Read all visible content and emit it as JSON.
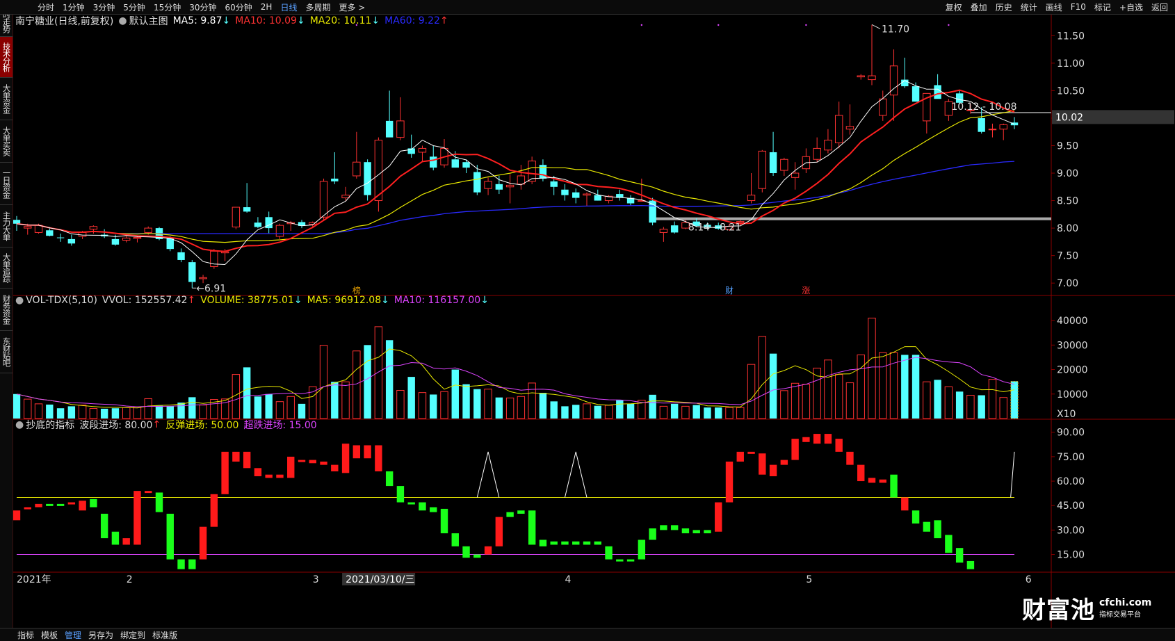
{
  "topbar": {
    "left": [
      "分时",
      "1分钟",
      "3分钟",
      "5分钟",
      "15分钟",
      "30分钟",
      "60分钟",
      "2H",
      "日线",
      "多周期",
      "更多 >"
    ],
    "active": "日线",
    "right": [
      "复权",
      "叠加",
      "历史",
      "统计",
      "画线",
      "F10",
      "标记",
      "+自选",
      "返回"
    ]
  },
  "sidebar": [
    {
      "label": "分时走势",
      "h": 52
    },
    {
      "label": "技术分析",
      "h": 58,
      "active": true
    },
    {
      "label": "大单资金",
      "h": 60
    },
    {
      "label": "大单买卖",
      "h": 60
    },
    {
      "label": "一日资金",
      "h": 60
    },
    {
      "label": "主力大单",
      "h": 60
    },
    {
      "label": "大单追踪",
      "h": 58
    },
    {
      "label": "财务资金",
      "h": 60
    },
    {
      "label": "东财贴吧",
      "h": 60
    }
  ],
  "main_header": {
    "title": "南宁糖业(日线,前复权)",
    "template": "默认主图",
    "ma5": "MA5: 9.87",
    "ma5_arrow": "↓",
    "ma10": "MA10: 10.09",
    "ma10_arrow": "↓",
    "ma20": "MA20: 10.11",
    "ma20_arrow": "↓",
    "ma60": "MA60: 9.22",
    "ma60_arrow": "↑"
  },
  "vol_header": {
    "name": "VOL-TDX(5,10)",
    "vvol": "VVOL: 152557.42",
    "vvol_arrow": "↑",
    "volume": "VOLUME: 38775.01",
    "volume_arrow": "↓",
    "ma5": "MA5: 96912.08",
    "ma5_arrow": "↓",
    "ma10": "MA10: 116157.00",
    "ma10_arrow": "↓"
  },
  "ind_header": {
    "name": "抄底的指标",
    "wave": "波段进场: 80.00",
    "wave_arrow": "↑",
    "rebound": "反弹进场: 50.00",
    "oversold": "超跌进场: 15.00"
  },
  "colors": {
    "up": "#ff3232",
    "down": "#54ffff",
    "ma5": "#ffffff",
    "ma10": "#ff2020",
    "ma20": "#e8e800",
    "ma60": "#2a2aff",
    "vma5": "#e8e800",
    "vma10": "#dd44ff",
    "line50": "#e8e800",
    "line15": "#dd44ff",
    "axis": "#8a0000"
  },
  "chart_data": {
    "type": "candlestick",
    "price_axis": [
      "11.50",
      "11.00",
      "10.50",
      "10.00",
      "9.50",
      "9.00",
      "8.50",
      "8.00",
      "7.50",
      "7.00"
    ],
    "vol_axis": [
      "40000",
      "30000",
      "20000",
      "10000"
    ],
    "vol_unit": "X10",
    "ind_axis": [
      "90.00",
      "75.00",
      "60.00",
      "45.00",
      "30.00",
      "15.00"
    ],
    "current_price": "10.02",
    "labels": {
      "high": "11.70",
      "low": "6.91",
      "resistance": "10.12 - 10.08",
      "support": "8.14 - 8.21"
    },
    "markers": [
      {
        "text": "榜",
        "day": "2021/03/10"
      },
      {
        "text": "财",
        "day": "2021/04/29"
      },
      {
        "text": "涨",
        "day": "2021/05/13"
      }
    ],
    "x_labels": [
      "2021年",
      "2",
      "3",
      "4",
      "5",
      "6"
    ],
    "cursor_date": "2021/03/10/三",
    "ohlc": [
      [
        8.15,
        8.22,
        7.95,
        8.08
      ],
      [
        8.0,
        8.08,
        7.88,
        8.03
      ],
      [
        7.92,
        8.08,
        7.9,
        8.05
      ],
      [
        7.96,
        8.02,
        7.85,
        7.86
      ],
      [
        7.83,
        7.9,
        7.75,
        7.82
      ],
      [
        7.8,
        7.88,
        7.68,
        7.72
      ],
      [
        7.85,
        7.95,
        7.8,
        7.92
      ],
      [
        7.98,
        8.05,
        7.9,
        8.03
      ],
      [
        7.88,
        7.98,
        7.82,
        7.85
      ],
      [
        7.8,
        7.88,
        7.68,
        7.7
      ],
      [
        7.78,
        7.85,
        7.74,
        7.82
      ],
      [
        7.81,
        7.87,
        7.74,
        7.83
      ],
      [
        7.92,
        8.03,
        7.88,
        8.0
      ],
      [
        8.0,
        8.02,
        7.78,
        7.8
      ],
      [
        7.82,
        7.85,
        7.58,
        7.62
      ],
      [
        7.56,
        7.63,
        7.38,
        7.42
      ],
      [
        7.38,
        7.42,
        6.91,
        7.02
      ],
      [
        7.08,
        7.15,
        7.0,
        7.1
      ],
      [
        7.3,
        7.62,
        7.26,
        7.58
      ],
      [
        7.55,
        7.62,
        7.4,
        7.57
      ],
      [
        8.02,
        8.38,
        7.98,
        8.38
      ],
      [
        8.38,
        8.82,
        8.28,
        8.3
      ],
      [
        8.1,
        8.2,
        8.0,
        8.02
      ],
      [
        8.2,
        8.3,
        7.9,
        8.0
      ],
      [
        7.85,
        8.08,
        7.8,
        8.05
      ],
      [
        8.08,
        8.13,
        7.95,
        8.1
      ],
      [
        8.11,
        8.15,
        8.0,
        8.04
      ],
      [
        8.07,
        8.12,
        8.0,
        8.1
      ],
      [
        8.2,
        8.9,
        8.15,
        8.85
      ],
      [
        8.9,
        9.38,
        8.8,
        8.85
      ],
      [
        8.55,
        8.75,
        8.5,
        8.6
      ],
      [
        8.95,
        9.75,
        8.9,
        9.2
      ],
      [
        9.2,
        9.25,
        8.5,
        8.6
      ],
      [
        8.5,
        9.65,
        8.3,
        9.6
      ],
      [
        9.95,
        10.5,
        9.8,
        9.65
      ],
      [
        9.65,
        10.38,
        9.6,
        9.95
      ],
      [
        9.45,
        9.7,
        9.28,
        9.35
      ],
      [
        9.38,
        9.5,
        9.2,
        9.45
      ],
      [
        9.3,
        9.5,
        9.05,
        9.1
      ],
      [
        9.15,
        9.62,
        9.1,
        9.45
      ],
      [
        9.25,
        9.4,
        9.1,
        9.1
      ],
      [
        9.2,
        9.25,
        9.0,
        9.1
      ],
      [
        9.02,
        9.15,
        8.6,
        8.65
      ],
      [
        8.72,
        8.92,
        8.6,
        8.85
      ],
      [
        8.8,
        8.95,
        8.62,
        8.7
      ],
      [
        8.75,
        8.98,
        8.45,
        8.78
      ],
      [
        8.8,
        9.15,
        8.7,
        8.95
      ],
      [
        8.85,
        9.3,
        8.8,
        9.22
      ],
      [
        9.15,
        9.25,
        8.85,
        8.9
      ],
      [
        8.85,
        8.95,
        8.6,
        8.75
      ],
      [
        8.7,
        8.8,
        8.5,
        8.6
      ],
      [
        8.65,
        8.72,
        8.45,
        8.55
      ],
      [
        8.6,
        8.65,
        8.4,
        8.62
      ],
      [
        8.6,
        8.7,
        8.5,
        8.5
      ],
      [
        8.5,
        8.6,
        8.45,
        8.58
      ],
      [
        8.62,
        8.7,
        8.5,
        8.55
      ],
      [
        8.55,
        8.6,
        8.4,
        8.45
      ],
      [
        8.5,
        8.9,
        8.5,
        8.5
      ],
      [
        8.5,
        8.55,
        8.05,
        8.1
      ],
      [
        7.92,
        8.02,
        7.75,
        7.98
      ],
      [
        8.05,
        8.12,
        7.9,
        7.92
      ],
      [
        8.0,
        8.15,
        7.98,
        8.1
      ],
      [
        8.12,
        8.18,
        8.02,
        8.04
      ],
      [
        8.06,
        8.1,
        7.98,
        8.02
      ],
      [
        8.05,
        8.1,
        7.97,
        7.99
      ],
      [
        7.97,
        8.08,
        7.95,
        8.03
      ],
      [
        8.1,
        8.15,
        8.05,
        8.12
      ],
      [
        8.5,
        9.0,
        8.45,
        8.6
      ],
      [
        8.72,
        9.42,
        8.65,
        9.4
      ],
      [
        9.38,
        9.75,
        8.95,
        9.0
      ],
      [
        9.05,
        9.28,
        8.95,
        9.25
      ],
      [
        8.92,
        9.2,
        8.7,
        9.0
      ],
      [
        9.08,
        9.45,
        9.0,
        9.3
      ],
      [
        9.25,
        9.65,
        9.2,
        9.45
      ],
      [
        9.42,
        9.8,
        9.36,
        9.6
      ],
      [
        9.55,
        10.3,
        9.45,
        10.05
      ],
      [
        9.8,
        10.25,
        9.7,
        9.85
      ],
      [
        10.75,
        10.8,
        10.7,
        10.77
      ],
      [
        10.7,
        11.7,
        10.6,
        10.77
      ],
      [
        10.05,
        10.5,
        9.95,
        10.35
      ],
      [
        10.42,
        11.25,
        9.95,
        10.95
      ],
      [
        10.7,
        11.1,
        10.55,
        10.58
      ],
      [
        10.58,
        10.65,
        10.3,
        10.3
      ],
      [
        9.95,
        10.35,
        9.72,
        10.45
      ],
      [
        10.6,
        10.8,
        10.38,
        10.35
      ],
      [
        10.05,
        10.35,
        9.95,
        10.3
      ],
      [
        10.45,
        10.5,
        10.25,
        10.28
      ],
      [
        10.15,
        10.26,
        10.08,
        10.15
      ],
      [
        10.0,
        10.2,
        9.72,
        9.75
      ],
      [
        9.8,
        9.9,
        9.65,
        9.8
      ],
      [
        9.8,
        9.9,
        9.6,
        9.88
      ],
      [
        9.92,
        10.02,
        9.8,
        9.87
      ]
    ],
    "volume": [
      10002,
      7920,
      6000,
      5700,
      4200,
      5000,
      5500,
      4100,
      4000,
      4200,
      4500,
      4800,
      8100,
      5200,
      5000,
      6500,
      8700,
      5500,
      7800,
      8000,
      18000,
      20900,
      9000,
      10000,
      6900,
      9000,
      6000,
      13000,
      29900,
      15000,
      15000,
      27600,
      30000,
      37500,
      32000,
      11500,
      17000,
      10600,
      9800,
      11000,
      20000,
      14000,
      12000,
      12000,
      8600,
      8400,
      9000,
      14500,
      10500,
      7000,
      5000,
      5600,
      6000,
      5200,
      5400,
      7500,
      6000,
      7500,
      9700,
      5000,
      6000,
      5000,
      5500,
      4500,
      4500,
      4500,
      4500,
      22100,
      33500,
      26500,
      11400,
      14400,
      14000,
      20600,
      23900,
      18000,
      14600,
      26000,
      41000,
      26900,
      26900,
      26000,
      26000,
      15000,
      15800,
      13000,
      11000,
      9500,
      9500,
      16000,
      8600,
      15200
    ],
    "indicator": [
      {
        "v": [
          36,
          42
        ],
        "c": "up"
      },
      {
        "v": [
          43,
          44
        ],
        "c": "up"
      },
      {
        "v": [
          44,
          46
        ],
        "c": "up"
      },
      {
        "v": [
          45,
          46
        ],
        "c": "down"
      },
      {
        "v": [
          45,
          46
        ],
        "c": "down"
      },
      {
        "v": [
          46,
          47
        ],
        "c": "up"
      },
      {
        "v": [
          42,
          48
        ],
        "c": "up"
      },
      {
        "v": [
          44,
          49
        ],
        "c": "down"
      },
      {
        "v": [
          25,
          40
        ],
        "c": "down"
      },
      {
        "v": [
          21,
          29
        ],
        "c": "down"
      },
      {
        "v": [
          21,
          25
        ],
        "c": "up"
      },
      {
        "v": [
          21,
          54
        ],
        "c": "up"
      },
      {
        "v": [
          53,
          54
        ],
        "c": "up"
      },
      {
        "v": [
          41,
          53
        ],
        "c": "down"
      },
      {
        "v": [
          12,
          40
        ],
        "c": "down"
      },
      {
        "v": [
          6,
          12
        ],
        "c": "down"
      },
      {
        "v": [
          6,
          12
        ],
        "c": "down"
      },
      {
        "v": [
          12,
          32
        ],
        "c": "up"
      },
      {
        "v": [
          32,
          52
        ],
        "c": "up"
      },
      {
        "v": [
          52,
          78
        ],
        "c": "up"
      },
      {
        "v": [
          72,
          78
        ],
        "c": "up"
      },
      {
        "v": [
          68,
          78
        ],
        "c": "up"
      },
      {
        "v": [
          63,
          68
        ],
        "c": "up"
      },
      {
        "v": [
          62,
          64
        ],
        "c": "up"
      },
      {
        "v": [
          62,
          64
        ],
        "c": "up"
      },
      {
        "v": [
          62,
          75
        ],
        "c": "up"
      },
      {
        "v": [
          72,
          73
        ],
        "c": "up"
      },
      {
        "v": [
          71,
          73
        ],
        "c": "up"
      },
      {
        "v": [
          70,
          72
        ],
        "c": "up"
      },
      {
        "v": [
          66,
          70
        ],
        "c": "up"
      },
      {
        "v": [
          65,
          83
        ],
        "c": "up"
      },
      {
        "v": [
          74,
          82
        ],
        "c": "up"
      },
      {
        "v": [
          74,
          82
        ],
        "c": "up"
      },
      {
        "v": [
          66,
          82
        ],
        "c": "up"
      },
      {
        "v": [
          57,
          66
        ],
        "c": "down"
      },
      {
        "v": [
          47,
          57
        ],
        "c": "down"
      },
      {
        "v": [
          47,
          47
        ],
        "c": "down"
      },
      {
        "v": [
          42,
          47
        ],
        "c": "down"
      },
      {
        "v": [
          41,
          44
        ],
        "c": "down"
      },
      {
        "v": [
          28,
          43
        ],
        "c": "down"
      },
      {
        "v": [
          20,
          28
        ],
        "c": "down"
      },
      {
        "v": [
          13,
          20
        ],
        "c": "down"
      },
      {
        "v": [
          13,
          15
        ],
        "c": "down"
      },
      {
        "v": [
          15,
          20
        ],
        "c": "up"
      },
      {
        "v": [
          20,
          38
        ],
        "c": "up"
      },
      {
        "v": [
          38,
          41
        ],
        "c": "down"
      },
      {
        "v": [
          40,
          42
        ],
        "c": "down"
      },
      {
        "v": [
          21,
          42
        ],
        "c": "down"
      },
      {
        "v": [
          20,
          24
        ],
        "c": "down"
      },
      {
        "v": [
          21,
          23
        ],
        "c": "down"
      },
      {
        "v": [
          21,
          23
        ],
        "c": "down"
      },
      {
        "v": [
          21,
          23
        ],
        "c": "down"
      },
      {
        "v": [
          21,
          23
        ],
        "c": "down"
      },
      {
        "v": [
          21,
          23
        ],
        "c": "down"
      },
      {
        "v": [
          12,
          20
        ],
        "c": "down"
      },
      {
        "v": [
          12,
          12
        ],
        "c": "down"
      },
      {
        "v": [
          12,
          12
        ],
        "c": "down"
      },
      {
        "v": [
          12,
          24
        ],
        "c": "down"
      },
      {
        "v": [
          24,
          31
        ],
        "c": "down"
      },
      {
        "v": [
          30,
          33
        ],
        "c": "down"
      },
      {
        "v": [
          30,
          33
        ],
        "c": "down"
      },
      {
        "v": [
          28,
          31
        ],
        "c": "down"
      },
      {
        "v": [
          28,
          30
        ],
        "c": "down"
      },
      {
        "v": [
          28,
          30
        ],
        "c": "down"
      },
      {
        "v": [
          29,
          47
        ],
        "c": "up"
      },
      {
        "v": [
          47,
          72
        ],
        "c": "up"
      },
      {
        "v": [
          72,
          78
        ],
        "c": "up"
      },
      {
        "v": [
          77,
          78
        ],
        "c": "up"
      },
      {
        "v": [
          64,
          77
        ],
        "c": "up"
      },
      {
        "v": [
          63,
          70
        ],
        "c": "up"
      },
      {
        "v": [
          70,
          73
        ],
        "c": "up"
      },
      {
        "v": [
          73,
          86
        ],
        "c": "up"
      },
      {
        "v": [
          84,
          87
        ],
        "c": "up"
      },
      {
        "v": [
          83,
          89
        ],
        "c": "up"
      },
      {
        "v": [
          83,
          89
        ],
        "c": "up"
      },
      {
        "v": [
          78,
          86
        ],
        "c": "up"
      },
      {
        "v": [
          70,
          78
        ],
        "c": "up"
      },
      {
        "v": [
          60,
          70
        ],
        "c": "up"
      },
      {
        "v": [
          59,
          62
        ],
        "c": "up"
      },
      {
        "v": [
          59,
          61
        ],
        "c": "up"
      },
      {
        "v": [
          50,
          64
        ],
        "c": "down"
      },
      {
        "v": [
          42,
          50
        ],
        "c": "up"
      },
      {
        "v": [
          34,
          42
        ],
        "c": "down"
      },
      {
        "v": [
          29,
          35
        ],
        "c": "down"
      },
      {
        "v": [
          25,
          36
        ],
        "c": "down"
      },
      {
        "v": [
          16,
          27
        ],
        "c": "down"
      },
      {
        "v": [
          10,
          19
        ],
        "c": "down"
      },
      {
        "v": [
          6,
          11
        ],
        "c": "down"
      }
    ],
    "signal_spikes": [
      43,
      51,
      83
    ],
    "last_signal": 83
  },
  "bottombar": [
    "指标",
    "模板",
    "管理",
    "另存为",
    "绑定到",
    "标准版"
  ],
  "bottom_active": "管理",
  "logo": {
    "text": "财富池",
    "site": "cfchi.com",
    "tagline": "指标交易平台"
  }
}
